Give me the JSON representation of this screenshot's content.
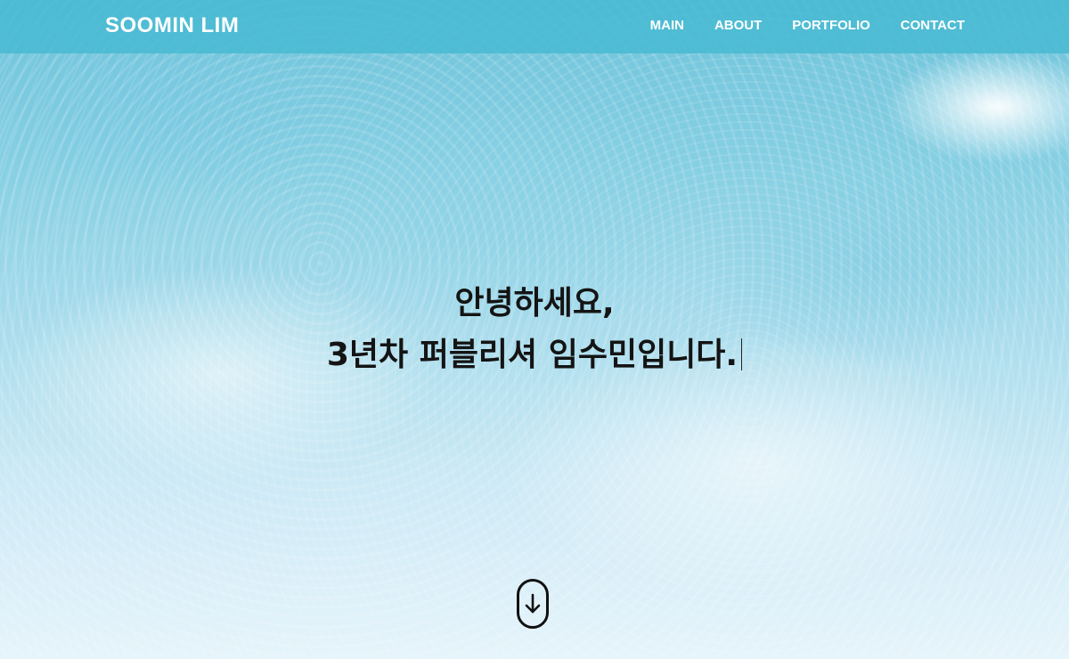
{
  "header": {
    "logo": "SOOMIN LIM",
    "nav": [
      {
        "label": "MAIN"
      },
      {
        "label": "ABOUT"
      },
      {
        "label": "PORTFOLIO"
      },
      {
        "label": "CONTACT"
      }
    ]
  },
  "hero": {
    "line1": "안녕하세요,",
    "line2": "3년차 퍼블리셔 임수민입니다."
  },
  "scroll": {
    "icon": "arrow-down-icon"
  },
  "colors": {
    "header_bg": "#46b9d2",
    "hero_text": "#141414"
  }
}
